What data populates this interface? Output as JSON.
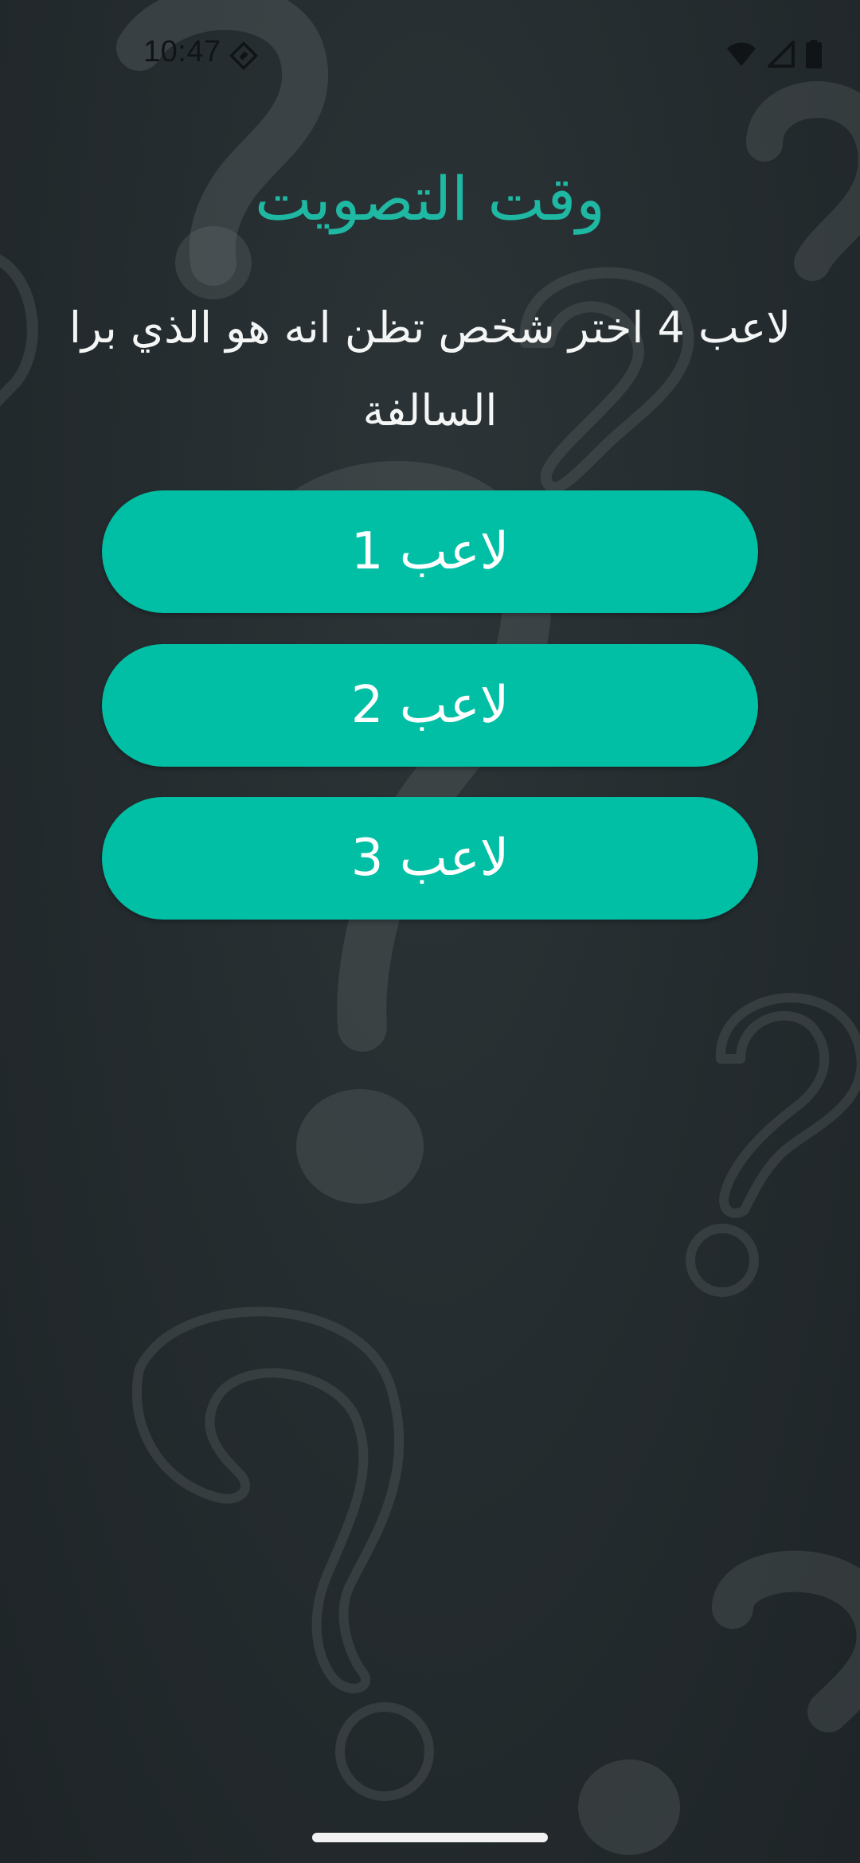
{
  "status_bar": {
    "time": "10:47",
    "icons": [
      "app-notification-icon",
      "wifi-icon",
      "signal-icon",
      "battery-icon"
    ]
  },
  "screen": {
    "title": "وقت التصويت",
    "prompt": "لاعب 4 اختر شخص تظن انه هو الذي برا السالفة"
  },
  "players": [
    {
      "label": "لاعب 1"
    },
    {
      "label": "لاعب 2"
    },
    {
      "label": "لاعب 3"
    }
  ],
  "colors": {
    "accent": "#00bfa5",
    "title": "#1fb8a3",
    "background": "#242b2e",
    "text": "#f4f6f6"
  }
}
